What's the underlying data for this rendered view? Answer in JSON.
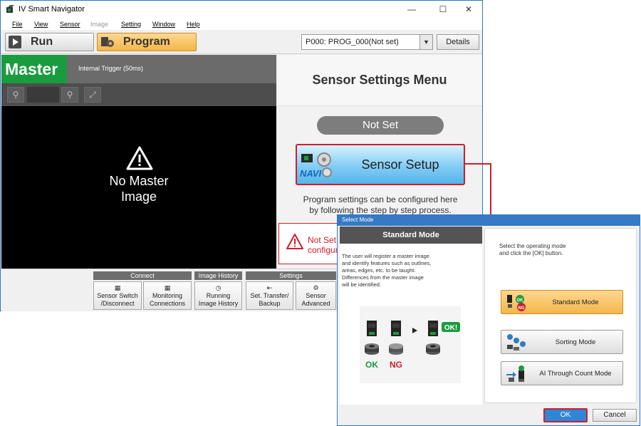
{
  "window": {
    "title": "IV Smart Navigator",
    "minimize": "—",
    "maximize": "☐",
    "close": "✕"
  },
  "menu": {
    "file": "File",
    "view": "View",
    "sensor": "Sensor",
    "image": "Image",
    "setting": "Setting",
    "window": "Window",
    "help": "Help"
  },
  "toolbar": {
    "run_label": "Run",
    "program_label": "Program",
    "program_select_value": "P000: PROG_000(Not set)",
    "details_label": "Details"
  },
  "image_panel": {
    "master_label": "Master",
    "trigger_text": "Internal Trigger (50ms)",
    "no_master_line1": "No Master",
    "no_master_line2": "Image"
  },
  "sensor_menu": {
    "title": "Sensor Settings Menu",
    "status": "Not Set",
    "setup_button_label": "Sensor Setup",
    "navi_badge": "NAVI",
    "description_line1": "Program settings can be configured here",
    "description_line2": "by following the step by step process.",
    "warning_line1": "Not Set.",
    "warning_line2": "configur"
  },
  "ribbon": {
    "groups": {
      "connect": "Connect",
      "image_history": "Image History",
      "settings": "Settings"
    },
    "buttons": {
      "sensor_switch_1": "Sensor Switch",
      "sensor_switch_2": "/Disconnect",
      "monitoring_1": "Monitoring",
      "monitoring_2": "Connections",
      "running_1": "Running",
      "running_2": "Image History",
      "set_transfer_1": "Set. Transfer/",
      "set_transfer_2": "Backup",
      "sensor_adv_1": "Sensor",
      "sensor_adv_2": "Advanced"
    }
  },
  "dialog": {
    "title": "Select Mode",
    "mode_header": "Standard Mode",
    "description": [
      "The user will register a master image",
      "and identify features such as outlines,",
      "areas, edges, etc. to be taught.",
      "Differences from the master image",
      "will be identified."
    ],
    "illustration": {
      "ok_label": "OK",
      "ng_label": "NG",
      "ok_badge": "OK!"
    },
    "instruction_line1": "Select the operating mode",
    "instruction_line2": "and click the [OK] button.",
    "modes": [
      {
        "label": "Standard Mode",
        "selected": true
      },
      {
        "label": "Sorting Mode",
        "selected": false
      },
      {
        "label": "AI Through Count Mode",
        "selected": false
      }
    ],
    "ok_label": "OK",
    "cancel_label": "Cancel"
  },
  "colors": {
    "master_green": "#1a9b3e",
    "highlight_red": "#cc1f2b",
    "program_orange": "#f4b64a",
    "dialog_blue": "#3679c4"
  }
}
